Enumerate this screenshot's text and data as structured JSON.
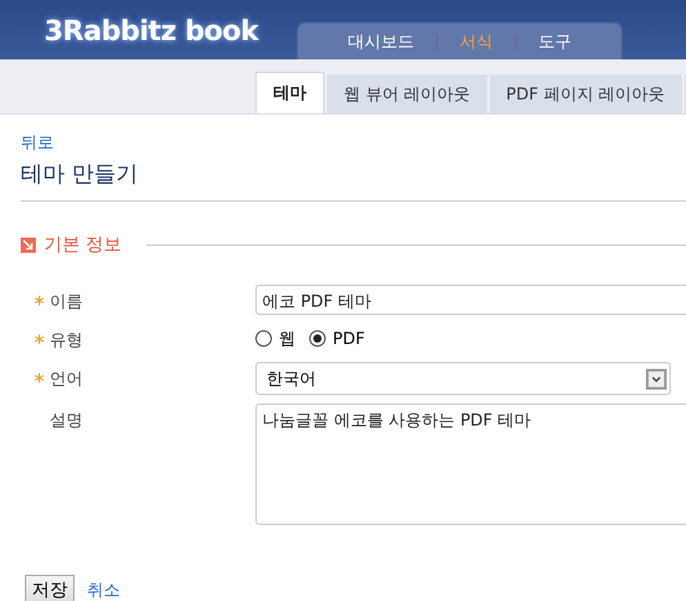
{
  "logo": "3Rabbitz book",
  "main_nav": [
    {
      "label": "대시보드",
      "selected": false
    },
    {
      "label": "서식",
      "selected": true
    },
    {
      "label": "도구",
      "selected": false
    }
  ],
  "tabs": [
    {
      "label": "테마",
      "selected": true
    },
    {
      "label": "웹 뷰어 레이아웃",
      "selected": false
    },
    {
      "label": "PDF 페이지 레이아웃",
      "selected": false
    },
    {
      "selected": false
    }
  ],
  "back_link": "뒤로",
  "page_title": "테마 만들기",
  "section": {
    "title": "기본 정보"
  },
  "fields": [
    {
      "kind": "text",
      "label": "이름",
      "required": true,
      "value": "에코 PDF 테마"
    },
    {
      "kind": "radio",
      "label": "유형",
      "required": true,
      "options": [
        {
          "label": "웹",
          "selected": false
        },
        {
          "label": "PDF",
          "selected": true
        }
      ]
    },
    {
      "kind": "select",
      "label": "언어",
      "required": true,
      "value": "한국어"
    },
    {
      "kind": "textarea",
      "label": "설명",
      "required": false,
      "value": "나눔글꼴 에코를 사용하는 PDF 테마"
    }
  ],
  "buttons": {
    "save": "저장",
    "cancel": "취소"
  }
}
